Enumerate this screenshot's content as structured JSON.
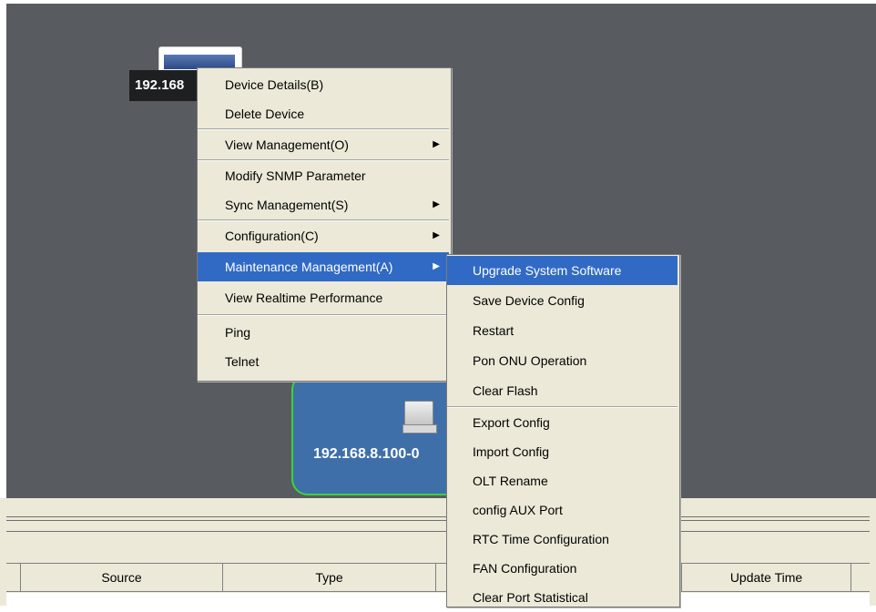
{
  "topology": {
    "device1_label": "192.168",
    "device2_label": "192.168.8.100-0"
  },
  "bottom_panel": {
    "columns": [
      "",
      "Source",
      "Type",
      "",
      "",
      "Update Time",
      ""
    ]
  },
  "context_menu": {
    "items": [
      {
        "label": "Device Details(B)",
        "has_submenu": false
      },
      {
        "label": "Delete Device",
        "has_submenu": false
      },
      {
        "label": "View Management(O)",
        "has_submenu": true
      },
      {
        "label": "Modify SNMP Parameter",
        "has_submenu": false
      },
      {
        "label": "Sync Management(S)",
        "has_submenu": true
      },
      {
        "label": "Configuration(C)",
        "has_submenu": true
      },
      {
        "label": "Maintenance Management(A)",
        "has_submenu": true,
        "active": true
      },
      {
        "label": "View Realtime Performance",
        "has_submenu": false
      },
      {
        "label": "Ping",
        "has_submenu": false
      },
      {
        "label": "Telnet",
        "has_submenu": false
      }
    ],
    "submenu_arrow": "▶"
  },
  "submenu": {
    "items": [
      {
        "label": "Upgrade System Software",
        "active": true
      },
      {
        "label": "Save Device Config"
      },
      {
        "label": "Restart"
      },
      {
        "label": "Pon ONU Operation"
      },
      {
        "label": "Clear Flash"
      },
      {
        "label": "Export Config"
      },
      {
        "label": "Import Config"
      },
      {
        "label": "OLT Rename"
      },
      {
        "label": "config AUX Port"
      },
      {
        "label": "RTC Time Configuration"
      },
      {
        "label": "FAN Configuration"
      },
      {
        "label": "Clear Port Statistical"
      }
    ]
  },
  "colors": {
    "canvas_bg": "#585b5f",
    "menu_bg": "#ece9d8",
    "highlight": "#316ac5",
    "link": "#3ad43a"
  }
}
